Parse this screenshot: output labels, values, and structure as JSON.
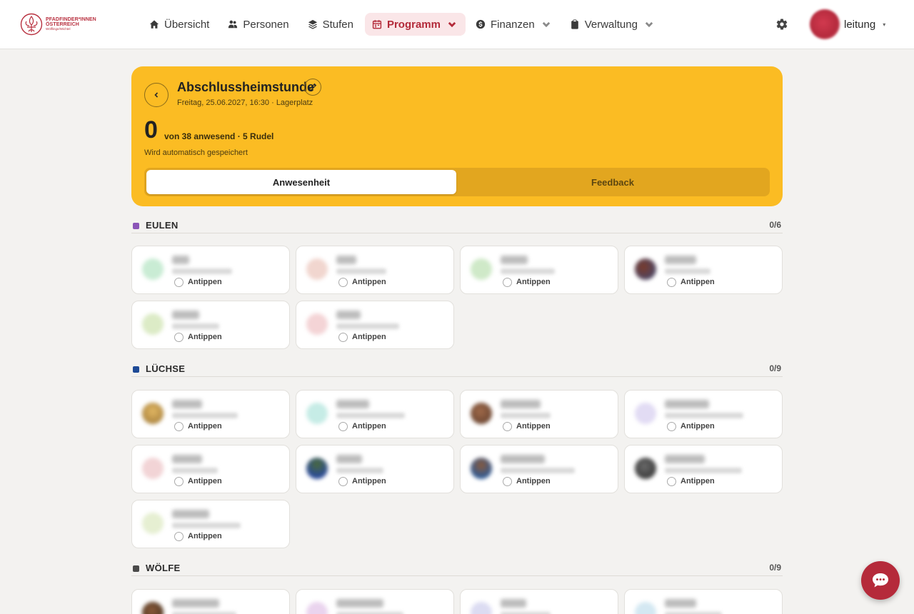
{
  "nav": {
    "logo_line1": "PFADFINDER*INNEN",
    "logo_line2": "ÖSTERREICH",
    "logo_line3": "Wölflinge/Wichtel",
    "items": [
      {
        "label": "Übersicht",
        "icon": "home-icon",
        "active": false,
        "dropdown": false
      },
      {
        "label": "Personen",
        "icon": "people-icon",
        "active": false,
        "dropdown": false
      },
      {
        "label": "Stufen",
        "icon": "layers-icon",
        "active": false,
        "dropdown": false
      },
      {
        "label": "Programm",
        "icon": "calendar-icon",
        "active": true,
        "dropdown": true
      },
      {
        "label": "Finanzen",
        "icon": "dollar-icon",
        "active": false,
        "dropdown": true
      },
      {
        "label": "Verwaltung",
        "icon": "clipboard-icon",
        "active": false,
        "dropdown": true
      }
    ],
    "user_name": "leitung",
    "user_caret": "▾"
  },
  "colors": {
    "accent": "#b32a3a",
    "hero": "#fbbc23",
    "eulen": "#8b55b8",
    "luechse": "#1e4a96",
    "woelfe": "#4a4a4a"
  },
  "event": {
    "title": "Abschlussheimstunde",
    "subtitle": "Freitag, 25.06.2027, 16:30 · Lagerplatz",
    "present_count": "0",
    "count_text": "von 38 anwesend · 5 Rudel",
    "saved_text": "Wird automatisch gespeichert"
  },
  "tabs": {
    "attendance": "Anwesenheit",
    "feedback": "Feedback"
  },
  "card_action": "Antippen",
  "groups": [
    {
      "name": "EULEN",
      "count": "0/6"
    },
    {
      "name": "LÜCHSE",
      "count": "0/9"
    },
    {
      "name": "WÖLFE",
      "count": "0/9"
    }
  ]
}
